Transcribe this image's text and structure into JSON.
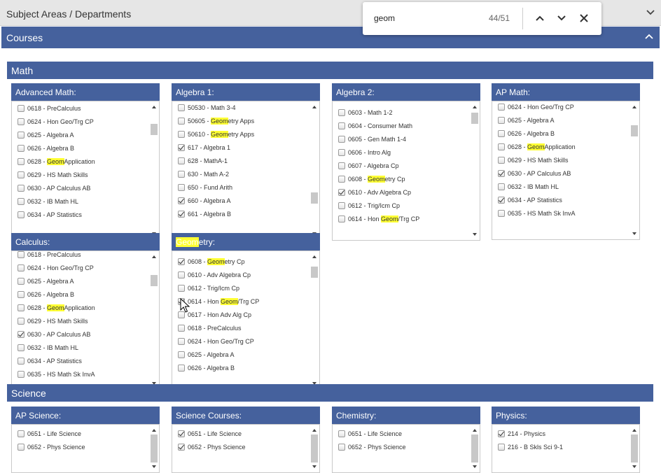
{
  "top_bar": {
    "title": "Subject Areas / Departments"
  },
  "courses_bar": {
    "title": "Courses"
  },
  "find": {
    "query": "geom",
    "count": "44/51"
  },
  "sections": [
    {
      "title": "Math",
      "panels": [
        {
          "title": "Advanced Math:",
          "items": [
            {
              "label": "0618 - PreCalculus",
              "checked": false
            },
            {
              "label": "0624 - Hon Geo/Trg CP",
              "checked": false
            },
            {
              "label": "0625 - Algebra A",
              "checked": false
            },
            {
              "label": "0626 - Algebra B",
              "checked": false
            },
            {
              "label": "0628 - GeomApplication",
              "checked": false
            },
            {
              "label": "0629 - HS Math Skills",
              "checked": false
            },
            {
              "label": "0630 - AP Calculus AB",
              "checked": false
            },
            {
              "label": "0632 - IB Math HL",
              "checked": false
            },
            {
              "label": "0634 - AP Statistics",
              "checked": false
            }
          ]
        },
        {
          "title": "Algebra 1:",
          "items": [
            {
              "label": "50530 - Math 3-4",
              "checked": false
            },
            {
              "label": "50605 - Geometry Apps",
              "checked": false
            },
            {
              "label": "50610 - Geometry Apps",
              "checked": false
            },
            {
              "label": "617 - Algebra 1",
              "checked": true
            },
            {
              "label": "628 - MathA-1",
              "checked": false
            },
            {
              "label": "630 - Math A-2",
              "checked": false
            },
            {
              "label": "650 - Fund Arith",
              "checked": false
            },
            {
              "label": "660 - Algebra A",
              "checked": true
            },
            {
              "label": "661 - Algebra B",
              "checked": true
            }
          ]
        },
        {
          "title": "Algebra 2:",
          "items": [
            {
              "label": "0603 - Math 1-2",
              "checked": false
            },
            {
              "label": "0604 - Consumer Math",
              "checked": false
            },
            {
              "label": "0605 - Gen Math 1-4",
              "checked": false
            },
            {
              "label": "0606 - Intro Alg",
              "checked": false
            },
            {
              "label": "0607 - Algebra Cp",
              "checked": false
            },
            {
              "label": "0608 - Geometry Cp",
              "checked": false
            },
            {
              "label": "0610 - Adv Algebra Cp",
              "checked": true
            },
            {
              "label": "0612 - Trig/Icm Cp",
              "checked": false
            },
            {
              "label": "0614 - Hon Geom/Trg CP",
              "checked": false
            }
          ]
        },
        {
          "title": "AP Math:",
          "items": [
            {
              "label": "0624 - Hon Geo/Trg CP",
              "checked": false
            },
            {
              "label": "0625 - Algebra A",
              "checked": false
            },
            {
              "label": "0626 - Algebra B",
              "checked": false
            },
            {
              "label": "0628 - GeomApplication",
              "checked": false
            },
            {
              "label": "0629 - HS Math Skills",
              "checked": false
            },
            {
              "label": "0630 - AP Calculus AB",
              "checked": true
            },
            {
              "label": "0632 - IB Math HL",
              "checked": false
            },
            {
              "label": "0634 - AP Statistics",
              "checked": true
            },
            {
              "label": "0635 - HS Math Sk InvA",
              "checked": false
            }
          ]
        },
        {
          "title": "Calculus:",
          "items": [
            {
              "label": "0618 - PreCalculus",
              "checked": false
            },
            {
              "label": "0624 - Hon Geo/Trg CP",
              "checked": false
            },
            {
              "label": "0625 - Algebra A",
              "checked": false
            },
            {
              "label": "0626 - Algebra B",
              "checked": false
            },
            {
              "label": "0628 - GeomApplication",
              "checked": false
            },
            {
              "label": "0629 - HS Math Skills",
              "checked": false
            },
            {
              "label": "0630 - AP Calculus AB",
              "checked": true
            },
            {
              "label": "0632 - IB Math HL",
              "checked": false
            },
            {
              "label": "0634 - AP Statistics",
              "checked": false
            },
            {
              "label": "0635 - HS Math Sk InvA",
              "checked": false
            }
          ]
        },
        {
          "title": "Geometry:",
          "items": [
            {
              "label": "0608 - Geometry Cp",
              "checked": true
            },
            {
              "label": "0610 - Adv Algebra Cp",
              "checked": false
            },
            {
              "label": "0612 - Trig/Icm Cp",
              "checked": false
            },
            {
              "label": "0614 - Hon Geom/Trg CP",
              "checked": true
            },
            {
              "label": "0617 - Hon Adv Alg Cp",
              "checked": false
            },
            {
              "label": "0618 - PreCalculus",
              "checked": false
            },
            {
              "label": "0624 - Hon Geo/Trg CP",
              "checked": false
            },
            {
              "label": "0625 - Algebra A",
              "checked": false
            },
            {
              "label": "0626 - Algebra B",
              "checked": false
            }
          ]
        }
      ]
    },
    {
      "title": "Science",
      "panels": [
        {
          "title": "AP Science:",
          "items": [
            {
              "label": "0651 - Life Science",
              "checked": false
            },
            {
              "label": "0652 - Phys Science",
              "checked": false
            }
          ]
        },
        {
          "title": "Science Courses:",
          "items": [
            {
              "label": "0651 - Life Science",
              "checked": true
            },
            {
              "label": "0652 - Phys Science",
              "checked": true
            }
          ]
        },
        {
          "title": "Chemistry:",
          "items": [
            {
              "label": "0651 - Life Science",
              "checked": false
            },
            {
              "label": "0652 - Phys Science",
              "checked": false
            }
          ]
        },
        {
          "title": "Physics:",
          "items": [
            {
              "label": "214 - Physics",
              "checked": true
            },
            {
              "label": "216 - B Skls Sci 9-1",
              "checked": false
            }
          ]
        }
      ]
    }
  ],
  "colors": {
    "header_blue": "#45619d",
    "highlight": "#ffff33"
  }
}
